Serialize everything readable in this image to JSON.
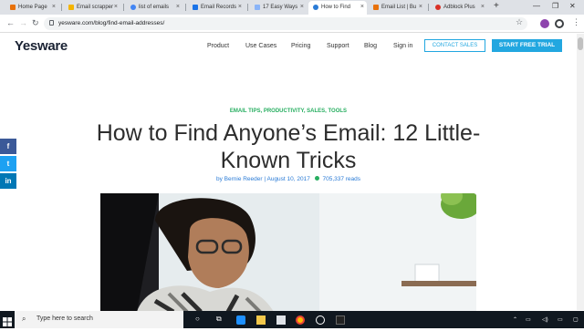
{
  "browser": {
    "tabs": [
      {
        "label": "Home Page",
        "color": "#e8710a"
      },
      {
        "label": "Email scrapper",
        "color": "#f4b400"
      },
      {
        "label": "list of emails",
        "color": "#4285f4"
      },
      {
        "label": "Email Records",
        "color": "#1a73e8"
      },
      {
        "label": "17 Easy Ways",
        "color": "#8ab4f8"
      },
      {
        "label": "How to Find",
        "color": "#2a7bd6"
      },
      {
        "label": "Email List | Bu",
        "color": "#e8710a"
      },
      {
        "label": "Adblock Plus",
        "color": "#d93025"
      }
    ],
    "active_tab": 5,
    "new_tab": "+",
    "url": "yesware.com/blog/find-email-addresses/",
    "tab_close": "×"
  },
  "site": {
    "logo": "Yesware",
    "menu": [
      "Product",
      "Use Cases",
      "Pricing",
      "Support",
      "Blog",
      "Sign in"
    ],
    "contact_button": "CONTACT SALES",
    "trial_button": "START FREE TRIAL"
  },
  "article": {
    "categories": "EMAIL TIPS, PRODUCTIVITY, SALES, TOOLS",
    "title": "How to Find Anyone’s Email: 12 Little-Known Tricks",
    "byline": "by Bernie Reeder | August 10, 2017",
    "reads": "705,337 reads"
  },
  "social": [
    {
      "glyph": "f",
      "color": "#3b5998",
      "icon": "facebook-icon"
    },
    {
      "glyph": "t",
      "color": "#1da1f2",
      "icon": "twitter-icon"
    },
    {
      "glyph": "in",
      "color": "#0077b5",
      "icon": "linkedin-icon"
    }
  ],
  "taskbar": {
    "search_placeholder": "Type here to search"
  },
  "colors": {
    "accent": "#22a7e0",
    "category_green": "#27ae60",
    "link_blue": "#2a7bd6"
  }
}
